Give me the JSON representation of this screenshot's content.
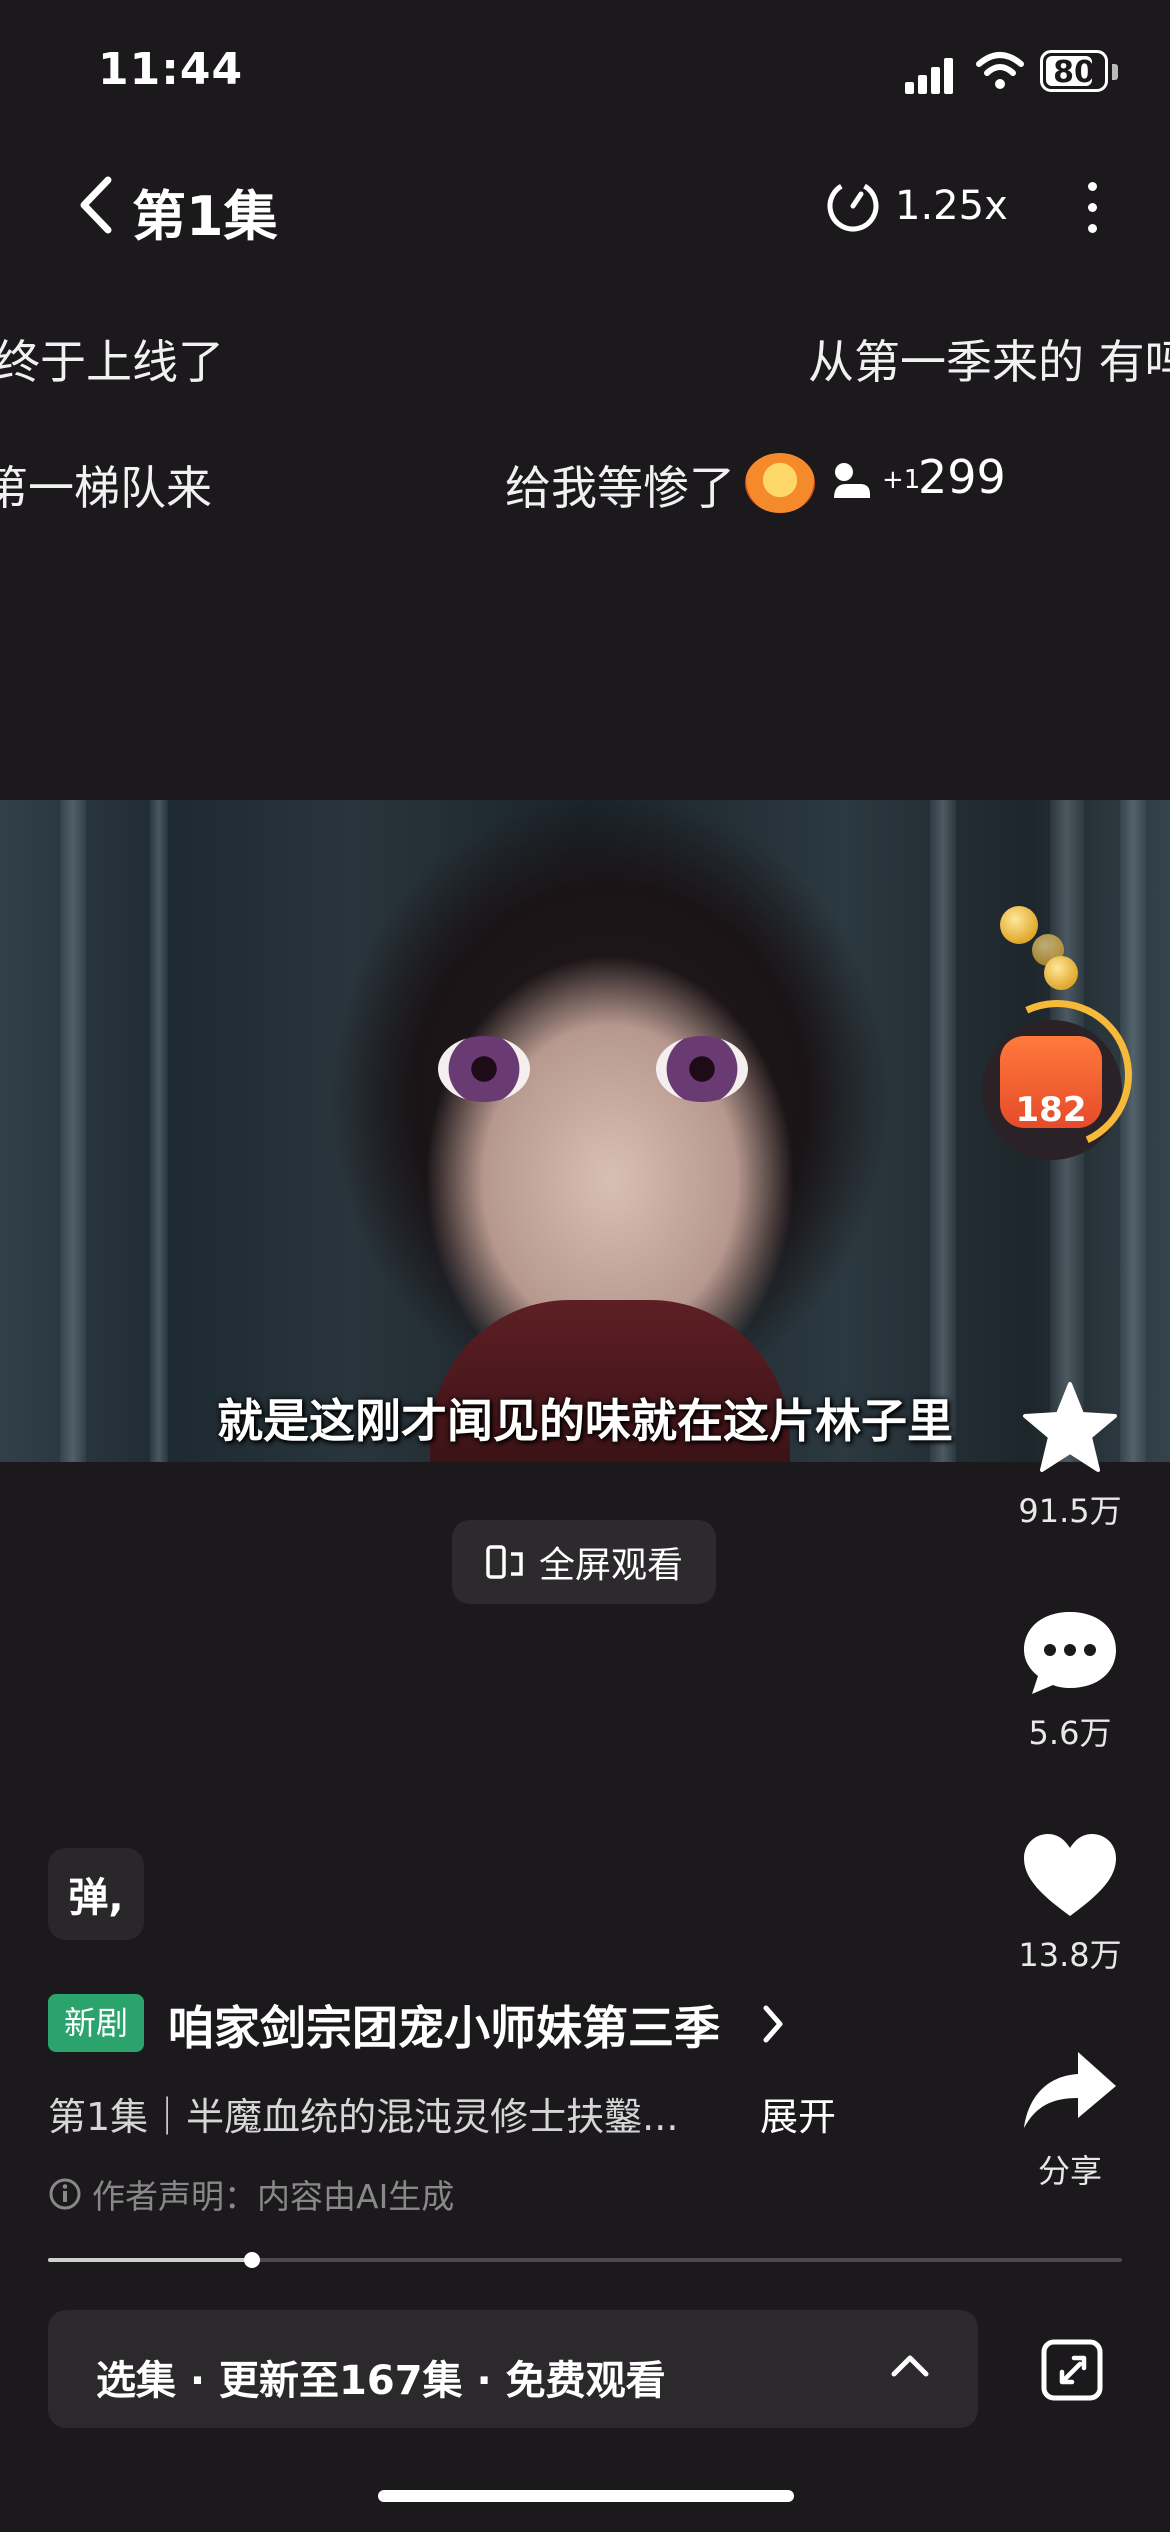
{
  "status_bar": {
    "time": "11:44",
    "battery": "80"
  },
  "nav": {
    "title": "第1集",
    "speed": "1.25x"
  },
  "danmaku": [
    {
      "text": "终于上线了"
    },
    {
      "text": "从第一季来的 有吗"
    },
    {
      "text": "第一梯队来"
    },
    {
      "text": "给我等惨了"
    }
  ],
  "danmaku_reaction": {
    "plus": "+1",
    "count": "299"
  },
  "video": {
    "subtitle": "就是这刚才闻见的味就在这片林子里"
  },
  "red_envelope": {
    "count": "182"
  },
  "fullscreen": {
    "label": "全屏观看"
  },
  "actions": {
    "favorite_count": "91.5万",
    "comment_count": "5.6万",
    "like_count": "13.8万",
    "share_label": "分享"
  },
  "danmaku_toggle": {
    "label": "弹,"
  },
  "series": {
    "badge": "新剧",
    "title": "咱家剑宗团宠小师妹第三季",
    "episode_desc": "第1集｜半魔血统的混沌灵修士扶鑿...",
    "expand": "展开",
    "author_note": "作者声明：内容由AI生成"
  },
  "playback": {
    "progress": 0.19
  },
  "selector": {
    "label": "选集 · 更新至167集 · 免费观看"
  },
  "colors": {
    "background": "#1c191d",
    "badge_green": "#2aa36c",
    "panel": "#2c292d"
  }
}
